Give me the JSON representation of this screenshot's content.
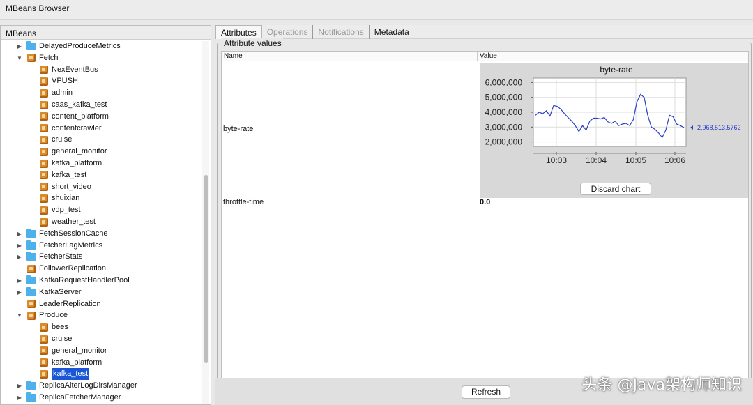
{
  "window": {
    "title": "MBeans Browser"
  },
  "tree": {
    "header": "MBeans",
    "rows": [
      {
        "label": "DelayedProduceMetrics",
        "icon": "folder-icon",
        "level": 1,
        "toggle": "▶"
      },
      {
        "label": "Fetch",
        "icon": "bean-icon",
        "level": 1,
        "toggle": "▼"
      },
      {
        "label": "NexEventBus",
        "icon": "bean-icon",
        "level": 2,
        "toggle": ""
      },
      {
        "label": "VPUSH",
        "icon": "bean-icon",
        "level": 2,
        "toggle": ""
      },
      {
        "label": "admin",
        "icon": "bean-icon",
        "level": 2,
        "toggle": ""
      },
      {
        "label": "caas_kafka_test",
        "icon": "bean-icon",
        "level": 2,
        "toggle": ""
      },
      {
        "label": "content_platform",
        "icon": "bean-icon",
        "level": 2,
        "toggle": ""
      },
      {
        "label": "contentcrawler",
        "icon": "bean-icon",
        "level": 2,
        "toggle": ""
      },
      {
        "label": "cruise",
        "icon": "bean-icon",
        "level": 2,
        "toggle": ""
      },
      {
        "label": "general_monitor",
        "icon": "bean-icon",
        "level": 2,
        "toggle": ""
      },
      {
        "label": "kafka_platform",
        "icon": "bean-icon",
        "level": 2,
        "toggle": ""
      },
      {
        "label": "kafka_test",
        "icon": "bean-icon",
        "level": 2,
        "toggle": ""
      },
      {
        "label": "short_video",
        "icon": "bean-icon",
        "level": 2,
        "toggle": ""
      },
      {
        "label": "shuixian",
        "icon": "bean-icon",
        "level": 2,
        "toggle": ""
      },
      {
        "label": "vdp_test",
        "icon": "bean-icon",
        "level": 2,
        "toggle": ""
      },
      {
        "label": "weather_test",
        "icon": "bean-icon",
        "level": 2,
        "toggle": ""
      },
      {
        "label": "FetchSessionCache",
        "icon": "folder-icon",
        "level": 1,
        "toggle": "▶"
      },
      {
        "label": "FetcherLagMetrics",
        "icon": "folder-icon",
        "level": 1,
        "toggle": "▶"
      },
      {
        "label": "FetcherStats",
        "icon": "folder-icon",
        "level": 1,
        "toggle": "▶"
      },
      {
        "label": "FollowerReplication",
        "icon": "bean-icon",
        "level": 1,
        "toggle": ""
      },
      {
        "label": "KafkaRequestHandlerPool",
        "icon": "folder-icon",
        "level": 1,
        "toggle": "▶"
      },
      {
        "label": "KafkaServer",
        "icon": "folder-icon",
        "level": 1,
        "toggle": "▶"
      },
      {
        "label": "LeaderReplication",
        "icon": "bean-icon",
        "level": 1,
        "toggle": ""
      },
      {
        "label": "Produce",
        "icon": "bean-icon",
        "level": 1,
        "toggle": "▼"
      },
      {
        "label": "bees",
        "icon": "bean-icon",
        "level": 2,
        "toggle": ""
      },
      {
        "label": "cruise",
        "icon": "bean-icon",
        "level": 2,
        "toggle": ""
      },
      {
        "label": "general_monitor",
        "icon": "bean-icon",
        "level": 2,
        "toggle": ""
      },
      {
        "label": "kafka_platform",
        "icon": "bean-icon",
        "level": 2,
        "toggle": ""
      },
      {
        "label": "kafka_test",
        "icon": "bean-icon",
        "level": 2,
        "toggle": "",
        "selected": true
      },
      {
        "label": "ReplicaAlterLogDirsManager",
        "icon": "folder-icon",
        "level": 1,
        "toggle": "▶"
      },
      {
        "label": "ReplicaFetcherManager",
        "icon": "folder-icon",
        "level": 1,
        "toggle": "▶"
      }
    ]
  },
  "tabs": [
    {
      "label": "Attributes",
      "state": "active"
    },
    {
      "label": "Operations",
      "state": "disabled"
    },
    {
      "label": "Notifications",
      "state": "disabled"
    },
    {
      "label": "Metadata",
      "state": "normal"
    }
  ],
  "attributes": {
    "group_title": "Attribute values",
    "columns": {
      "name": "Name",
      "value": "Value"
    },
    "rows": [
      {
        "name": "byte-rate",
        "value": ""
      },
      {
        "name": "throttle-time",
        "value": "0.0"
      }
    ],
    "discard_label": "Discard chart"
  },
  "refresh_label": "Refresh",
  "watermark": "头条 @Java架构师知识",
  "chart_data": {
    "type": "line",
    "title": "byte-rate",
    "x_ticks": [
      "10:03",
      "10:04",
      "10:05",
      "10:06"
    ],
    "y_ticks": [
      "6,000,000",
      "5,000,000",
      "4,000,000",
      "3,000,000",
      "2,000,000"
    ],
    "ylim": [
      1700000,
      6300000
    ],
    "current_value_label": "2,968,513.5762",
    "line_color": "#2b3fc4",
    "series": [
      {
        "values": [
          3800000,
          4000000,
          3900000,
          4100000,
          3750000,
          4450000,
          4400000,
          4200000,
          3900000,
          3650000,
          3400000,
          3100000,
          2700000,
          3100000,
          2800000,
          3400000,
          3600000,
          3600000,
          3550000,
          3650000,
          3350000,
          3250000,
          3400000,
          3100000,
          3200000,
          3250000,
          3100000,
          3500000,
          4700000,
          5200000,
          5000000,
          3800000,
          3000000,
          2850000,
          2600000,
          2300000,
          2800000,
          3800000,
          3700000,
          3200000,
          3100000,
          2968513.5762
        ]
      }
    ]
  }
}
